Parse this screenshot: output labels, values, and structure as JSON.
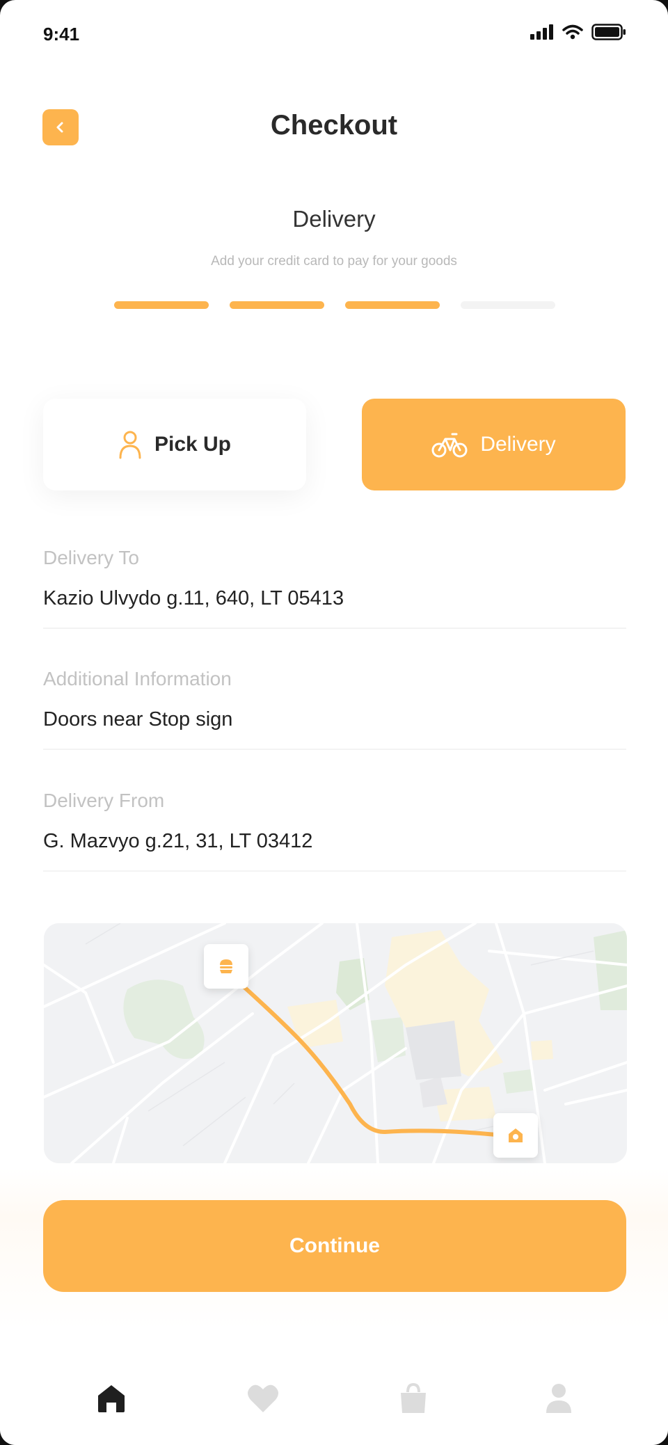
{
  "status_bar": {
    "time": "9:41"
  },
  "header": {
    "title": "Checkout"
  },
  "step": {
    "title": "Delivery",
    "subtitle": "Add your credit card to pay for your goods",
    "progress_total": 4,
    "progress_done": 3
  },
  "method_toggle": {
    "pickup_label": "Pick Up",
    "delivery_label": "Delivery",
    "selected": "delivery"
  },
  "fields": [
    {
      "label": "Delivery To",
      "value": "Kazio Ulvydo g.11, 640, LT 05413"
    },
    {
      "label": "Additional Information",
      "value": "Doors near Stop sign"
    },
    {
      "label": "Delivery From",
      "value": "G. Mazvyo g.21, 31, LT 03412"
    }
  ],
  "continue_label": "Continue",
  "tab_bar": {
    "items": [
      "home-icon",
      "heart-icon",
      "bag-icon",
      "profile-icon"
    ],
    "active": "home-icon"
  },
  "colors": {
    "accent": "#fdb44e",
    "text": "#2a2a2a",
    "muted": "#c2c2c2"
  }
}
